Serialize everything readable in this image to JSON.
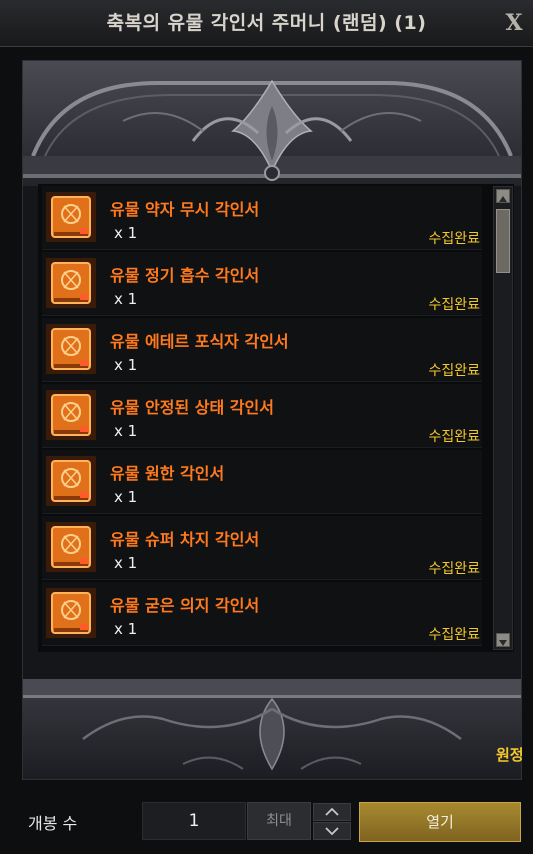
{
  "window": {
    "title": "축복의 유물 각인서 주머니 (랜덤) (1)",
    "close_label": "X"
  },
  "items": [
    {
      "name": "유물 약자 무시 각인서",
      "qty": "x 1",
      "status": "수집완료"
    },
    {
      "name": "유물 정기 흡수 각인서",
      "qty": "x 1",
      "status": "수집완료"
    },
    {
      "name": "유물 에테르 포식자 각인서",
      "qty": "x 1",
      "status": "수집완료"
    },
    {
      "name": "유물 안정된 상태 각인서",
      "qty": "x 1",
      "status": "수집완료"
    },
    {
      "name": "유물 원한 각인서",
      "qty": "x 1",
      "status": ""
    },
    {
      "name": "유물 슈퍼 차지 각인서",
      "qty": "x 1",
      "status": "수집완료"
    },
    {
      "name": "유물 굳은 의지 각인서",
      "qty": "x 1",
      "status": "수집완료"
    }
  ],
  "side_text": "원정",
  "footer": {
    "label": "개봉 수",
    "quantity": "1",
    "max_label": "최대",
    "open_label": "열기"
  },
  "colors": {
    "item_name": "#ff7a1e",
    "status": "#f2c82c",
    "open_button": "#a88930"
  },
  "icons": {
    "item": "engraving-book-icon",
    "spin_up": "chevron-up-icon",
    "spin_down": "chevron-down-icon"
  }
}
